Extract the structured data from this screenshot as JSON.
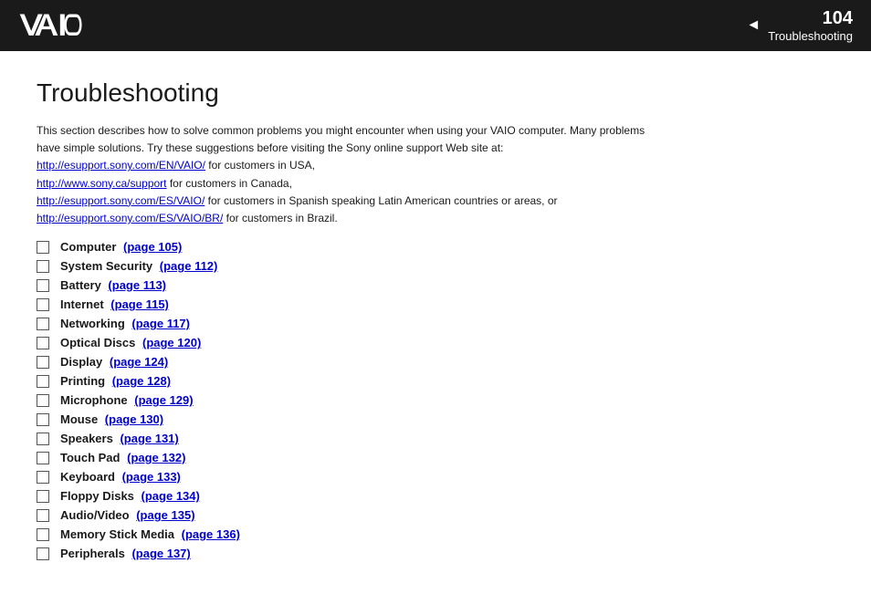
{
  "header": {
    "arrow": "◄",
    "page_number": "104",
    "section_title": "Troubleshooting",
    "logo_text": "VAIO"
  },
  "page": {
    "title": "Troubleshooting",
    "intro": {
      "line1": "This section describes how to solve common problems you might encounter when using your VAIO computer. Many problems",
      "line2": "have simple solutions. Try these suggestions before visiting the Sony online support Web site at:",
      "link1": "http://esupport.sony.com/EN/VAIO/",
      "link1_suffix": " for customers in USA,",
      "link2": "http://www.sony.ca/support",
      "link2_suffix": " for customers in Canada,",
      "link3": "http://esupport.sony.com/ES/VAIO/",
      "link3_suffix": " for customers in Spanish speaking Latin American countries or areas, or",
      "link4": "http://esupport.sony.com/ES/VAIO/BR/",
      "link4_suffix": " for customers in Brazil."
    },
    "items": [
      {
        "label": "Computer",
        "link": "(page 105)"
      },
      {
        "label": "System Security",
        "link": "(page 112)"
      },
      {
        "label": "Battery",
        "link": "(page 113)"
      },
      {
        "label": "Internet",
        "link": "(page 115)"
      },
      {
        "label": "Networking",
        "link": "(page 117)"
      },
      {
        "label": "Optical Discs",
        "link": "(page 120)"
      },
      {
        "label": "Display",
        "link": "(page 124)"
      },
      {
        "label": "Printing",
        "link": "(page 128)"
      },
      {
        "label": "Microphone",
        "link": "(page 129)"
      },
      {
        "label": "Mouse",
        "link": "(page 130)"
      },
      {
        "label": "Speakers",
        "link": "(page 131)"
      },
      {
        "label": "Touch Pad",
        "link": "(page 132)"
      },
      {
        "label": "Keyboard",
        "link": "(page 133)"
      },
      {
        "label": "Floppy Disks",
        "link": "(page 134)"
      },
      {
        "label": "Audio/Video",
        "link": "(page 135)"
      },
      {
        "label": "Memory Stick Media",
        "link": "(page 136)"
      },
      {
        "label": "Peripherals",
        "link": "(page 137)"
      }
    ]
  }
}
